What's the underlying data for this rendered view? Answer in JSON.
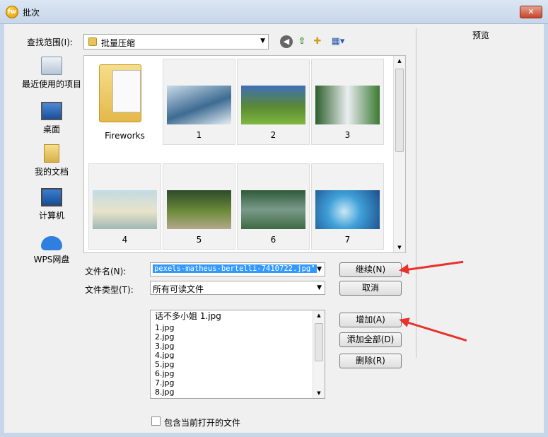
{
  "window": {
    "title": "批次",
    "app_icon_text": "fw",
    "close_label": "✕"
  },
  "toolbar": {
    "look_in_label": "查找范围(I):",
    "look_in_value": "批量压缩",
    "back_icon": "back-arrow-icon",
    "up_icon": "up-folder-icon",
    "new_folder_icon": "new-folder-icon",
    "view_icon": "view-menu-icon"
  },
  "places": [
    {
      "label": "最近使用的项目",
      "icon": "recent-items-icon"
    },
    {
      "label": "桌面",
      "icon": "desktop-icon"
    },
    {
      "label": "我的文档",
      "icon": "documents-icon"
    },
    {
      "label": "计算机",
      "icon": "computer-icon"
    },
    {
      "label": "WPS网盘",
      "icon": "cloud-drive-icon"
    }
  ],
  "files": [
    {
      "label": "Fireworks",
      "type": "folder"
    },
    {
      "label": "1",
      "type": "image",
      "colors": [
        "#c9dbe8",
        "#3d6b92",
        "#e6eef4"
      ]
    },
    {
      "label": "2",
      "type": "image",
      "colors": [
        "#3f6fb6",
        "#5a8a34",
        "#7fb83e"
      ]
    },
    {
      "label": "3",
      "type": "image",
      "colors": [
        "#2e5e2c",
        "#e9eef0",
        "#3b7a32"
      ]
    },
    {
      "label": "4",
      "type": "image",
      "colors": [
        "#c2dbe4",
        "#e9e3c9",
        "#9fb7b4"
      ]
    },
    {
      "label": "5",
      "type": "image",
      "colors": [
        "#2d4a2a",
        "#6e8c3a",
        "#b4a88c"
      ]
    },
    {
      "label": "6",
      "type": "image",
      "colors": [
        "#2f5a3a",
        "#7a9a8a",
        "#3e6a42"
      ]
    },
    {
      "label": "7",
      "type": "image",
      "colors": [
        "#1b4e8a",
        "#3fa0d8",
        "#c9e8f4"
      ]
    }
  ],
  "form": {
    "filename_label": "文件名(N):",
    "filename_value": "pexels-matheus-bertelli-7410722.jpg\"",
    "filetype_label": "文件类型(T):",
    "filetype_value": "所有可读文件"
  },
  "buttons": {
    "continue": "继续(N)",
    "cancel": "取消",
    "add": "增加(A)",
    "add_all": "添加全部(D)",
    "delete": "删除(R)"
  },
  "added_files": [
    "话不多小姐 1.jpg",
    "1.jpg",
    "2.jpg",
    "3.jpg",
    "4.jpg",
    "5.jpg",
    "6.jpg",
    "7.jpg",
    "8.jpg"
  ],
  "include_open_files_label": "包含当前打开的文件",
  "preview_label": "预览"
}
